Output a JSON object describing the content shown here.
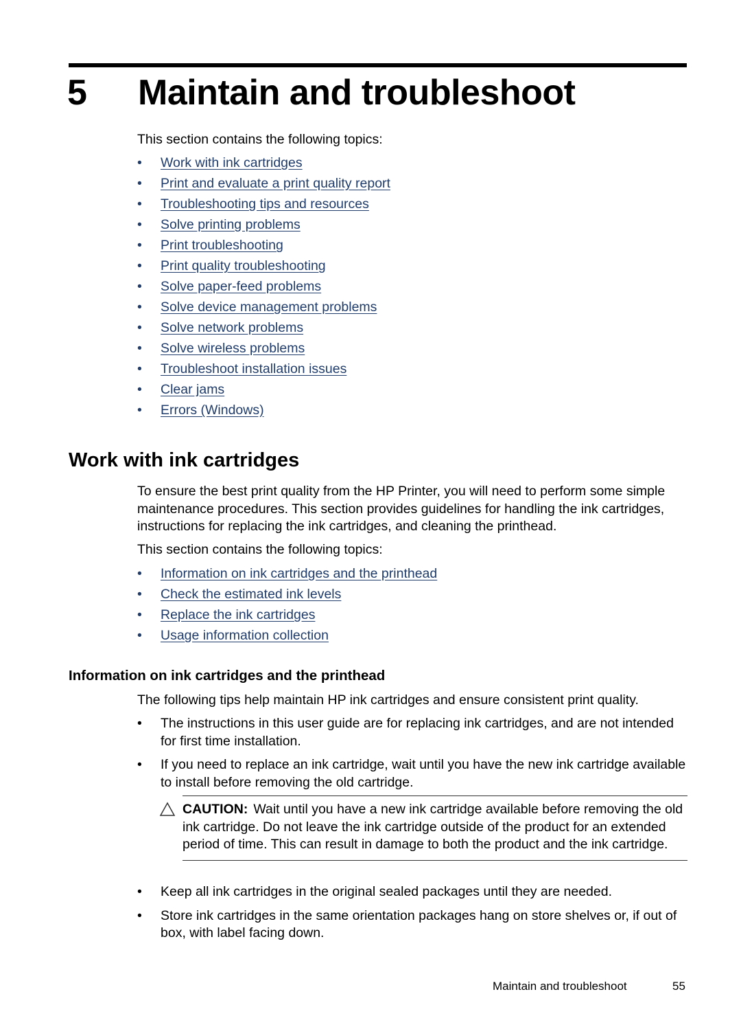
{
  "chapter": {
    "number": "5",
    "title": "Maintain and troubleshoot"
  },
  "intro": "This section contains the following topics:",
  "chapter_topics": [
    "Work with ink cartridges",
    "Print and evaluate a print quality report",
    "Troubleshooting tips and resources",
    "Solve printing problems",
    "Print troubleshooting",
    "Print quality troubleshooting",
    "Solve paper-feed problems",
    "Solve device management problems",
    "Solve network problems",
    "Solve wireless problems",
    "Troubleshoot installation issues",
    "Clear jams",
    "Errors (Windows)"
  ],
  "section": {
    "title": "Work with ink cartridges",
    "paragraph": "To ensure the best print quality from the HP Printer, you will need to perform some simple maintenance procedures. This section provides guidelines for handling the ink cartridges, instructions for replacing the ink cartridges, and cleaning the printhead.",
    "intro": "This section contains the following topics:",
    "topics": [
      "Information on ink cartridges and the printhead",
      "Check the estimated ink levels",
      "Replace the ink cartridges",
      "Usage information collection"
    ]
  },
  "subsection": {
    "title": "Information on ink cartridges and the printhead",
    "paragraph": "The following tips help maintain HP ink cartridges and ensure consistent print quality.",
    "bullets_before": [
      "The instructions in this user guide are for replacing ink cartridges, and are not intended for first time installation.",
      "If you need to replace an ink cartridge, wait until you have the new ink cartridge available to install before removing the old cartridge."
    ],
    "caution": {
      "icon": "caution-triangle-icon",
      "label": "CAUTION:",
      "text": "Wait until you have a new ink cartridge available before removing the old ink cartridge. Do not leave the ink cartridge outside of the product for an extended period of time. This can result in damage to both the product and the ink cartridge."
    },
    "bullets_after": [
      "Keep all ink cartridges in the original sealed packages until they are needed.",
      "Store ink cartridges in the same orientation packages hang on store shelves or, if out of box, with label facing down."
    ]
  },
  "footer": {
    "title": "Maintain and troubleshoot",
    "page": "55"
  },
  "colors": {
    "link": "#1f3c6b",
    "text": "#000000"
  }
}
